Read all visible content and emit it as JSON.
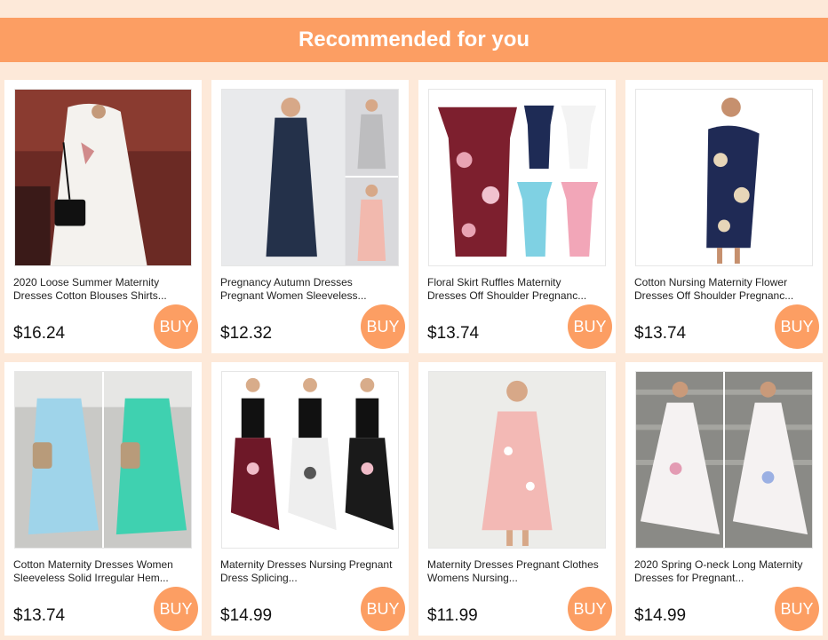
{
  "header": {
    "title": "Recommended for you"
  },
  "buy_label": "BUY",
  "colors": {
    "accent": "#fc9e63",
    "background": "#fde9d9"
  },
  "products": [
    {
      "title": "2020 Loose Summer Maternity Dresses Cotton Blouses Shirts...",
      "price": "$16.24"
    },
    {
      "title": "Pregnancy Autumn Dresses Pregnant Women Sleeveless...",
      "price": "$12.32"
    },
    {
      "title": "Floral Skirt Ruffles Maternity Dresses Off Shoulder Pregnanc...",
      "price": "$13.74"
    },
    {
      "title": "Cotton Nursing Maternity Flower Dresses Off Shoulder Pregnanc...",
      "price": "$13.74"
    },
    {
      "title": "Cotton Maternity Dresses Women Sleeveless Solid Irregular Hem...",
      "price": "$13.74"
    },
    {
      "title": "Maternity Dresses Nursing Pregnant Dress Splicing...",
      "price": "$14.99"
    },
    {
      "title": "Maternity Dresses Pregnant Clothes Womens Nursing...",
      "price": "$11.99"
    },
    {
      "title": "2020 Spring O-neck Long Maternity Dresses for Pregnant...",
      "price": "$14.99"
    }
  ]
}
